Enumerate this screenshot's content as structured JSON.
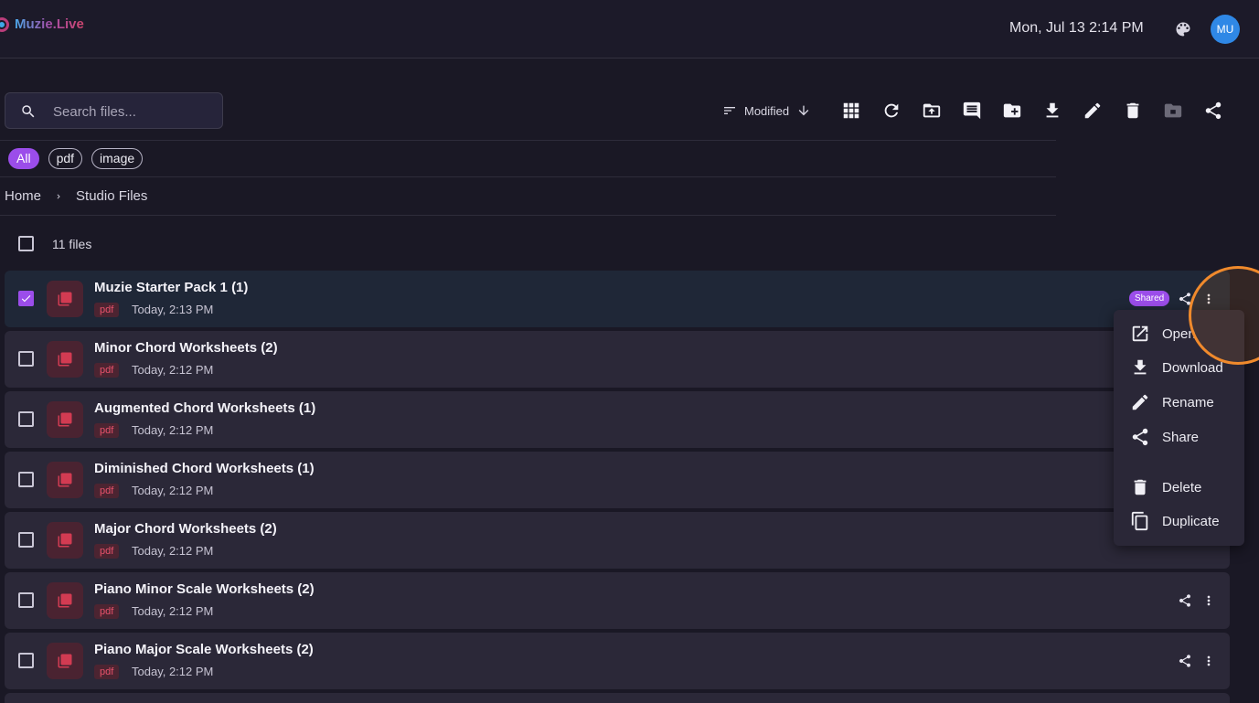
{
  "header": {
    "app_name": "Muzie.Live",
    "datetime": "Mon, Jul 13 2:14 PM",
    "avatar_initials": "MU",
    "brand_colors": [
      "#4aa7e8",
      "#a44ea8",
      "#d0456e"
    ]
  },
  "search": {
    "placeholder": "Search files..."
  },
  "toolbar": {
    "sort_label": "Modified",
    "buttons": [
      "grid-view-icon",
      "refresh-icon",
      "upload-icon",
      "comment-icon",
      "new-folder-icon",
      "download-icon",
      "rename-icon",
      "delete-icon",
      "archive-icon",
      "share-icon"
    ]
  },
  "filters": [
    {
      "label": "All",
      "active": true
    },
    {
      "label": "pdf",
      "active": false
    },
    {
      "label": "image",
      "active": false
    }
  ],
  "breadcrumb": {
    "home": "Home",
    "current": "Studio Files"
  },
  "list": {
    "count_label": "11 files",
    "shared_label": "Shared",
    "files": [
      {
        "name": "Muzie Starter Pack 1 (1)",
        "type": "pdf",
        "date": "Today, 2:13 PM",
        "selected": true,
        "shared": true
      },
      {
        "name": "Minor Chord Worksheets (2)",
        "type": "pdf",
        "date": "Today, 2:12 PM",
        "selected": false,
        "shared": false
      },
      {
        "name": "Augmented Chord Worksheets (1)",
        "type": "pdf",
        "date": "Today, 2:12 PM",
        "selected": false,
        "shared": false
      },
      {
        "name": "Diminished Chord Worksheets (1)",
        "type": "pdf",
        "date": "Today, 2:12 PM",
        "selected": false,
        "shared": false
      },
      {
        "name": "Major Chord Worksheets (2)",
        "type": "pdf",
        "date": "Today, 2:12 PM",
        "selected": false,
        "shared": false
      },
      {
        "name": "Piano Minor Scale Worksheets (2)",
        "type": "pdf",
        "date": "Today, 2:12 PM",
        "selected": false,
        "shared": false
      },
      {
        "name": "Piano Major Scale Worksheets (2)",
        "type": "pdf",
        "date": "Today, 2:12 PM",
        "selected": false,
        "shared": false
      }
    ]
  },
  "context_menu": {
    "items": [
      {
        "label": "Open",
        "icon": "open-external-icon"
      },
      {
        "label": "Download",
        "icon": "download-icon"
      },
      {
        "label": "Rename",
        "icon": "rename-icon"
      },
      {
        "label": "Share",
        "icon": "share-icon"
      },
      {
        "label": "Delete",
        "icon": "delete-icon"
      },
      {
        "label": "Duplicate",
        "icon": "duplicate-icon"
      }
    ]
  },
  "colors": {
    "accent": "#9b4dea",
    "highlight": "#f08a2c",
    "pdf_tag": "#e7526b"
  }
}
